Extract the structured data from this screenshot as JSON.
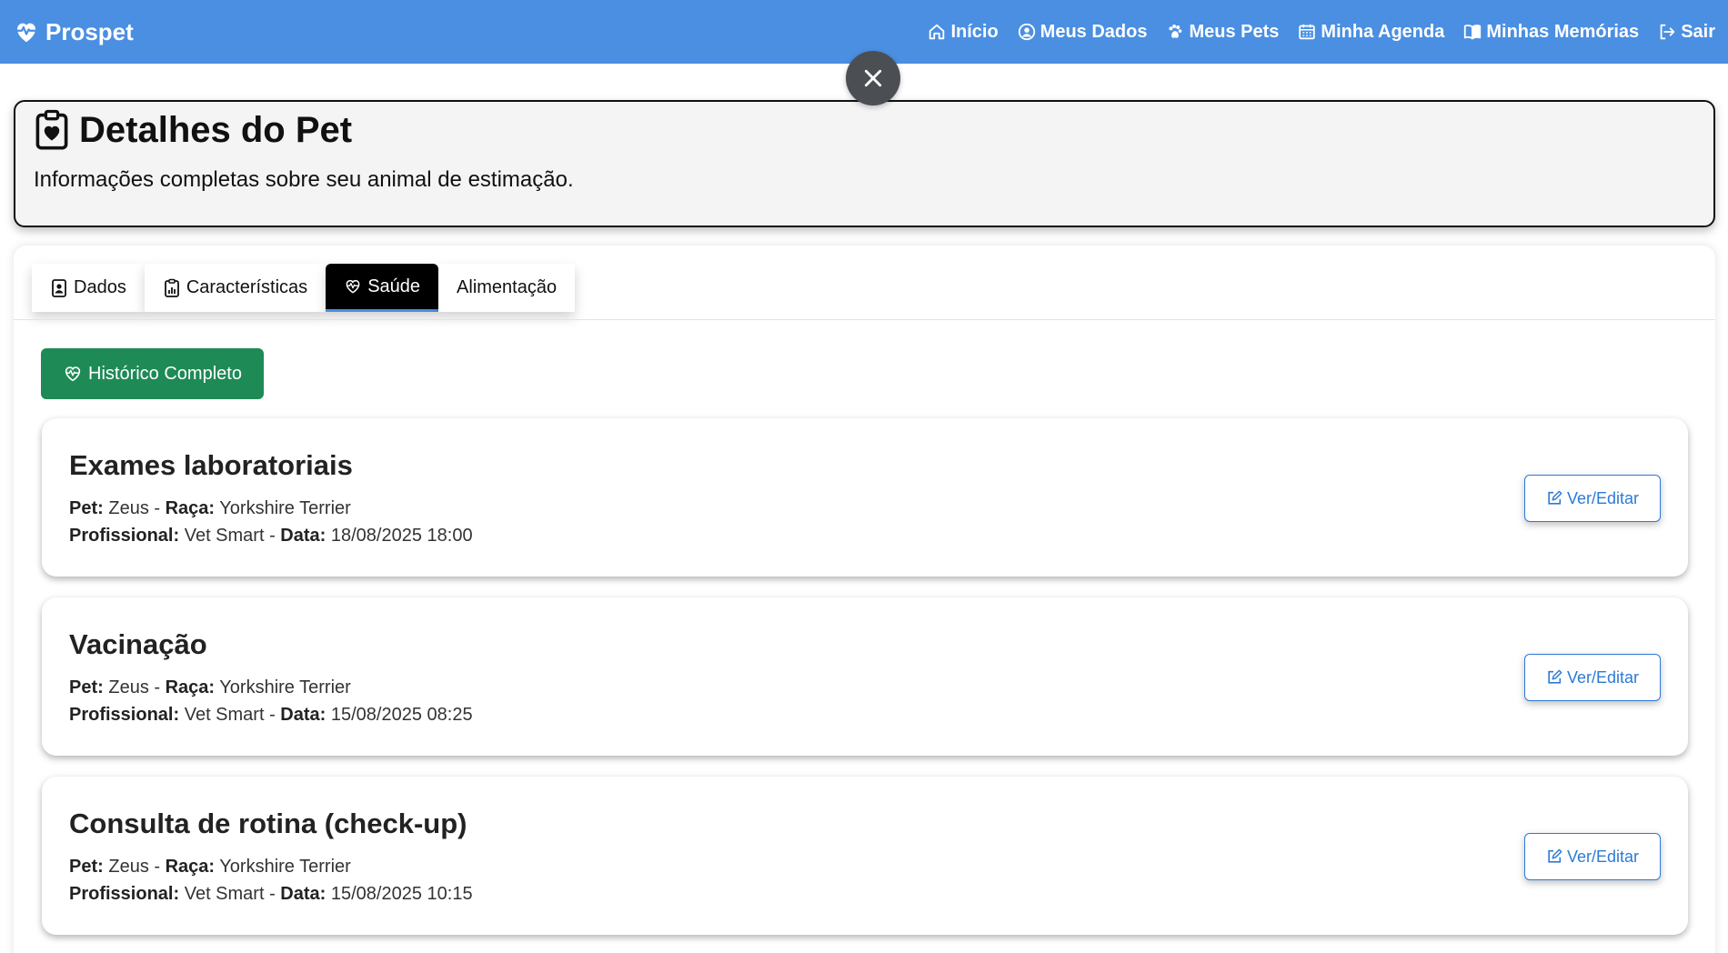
{
  "navbar": {
    "brand": "Prospet",
    "links": [
      {
        "label": "Início",
        "icon": "home-icon"
      },
      {
        "label": "Meus Dados",
        "icon": "user-circle-icon"
      },
      {
        "label": "Meus Pets",
        "icon": "paw-icon"
      },
      {
        "label": "Minha Agenda",
        "icon": "calendar-icon"
      },
      {
        "label": "Minhas Memórias",
        "icon": "book-icon"
      },
      {
        "label": "Sair",
        "icon": "logout-icon"
      }
    ]
  },
  "header": {
    "title": "Detalhes do Pet",
    "subtitle": "Informações completas sobre seu animal de estimação."
  },
  "tabs": [
    {
      "label": "Dados",
      "icon": "id-badge-icon",
      "active": false
    },
    {
      "label": "Características",
      "icon": "clipboard-chart-icon",
      "active": false
    },
    {
      "label": "Saúde",
      "icon": "heart-pulse-icon",
      "active": true
    },
    {
      "label": "Alimentação",
      "icon": "",
      "active": false
    }
  ],
  "history_button": "Histórico Completo",
  "labels": {
    "pet": "Pet:",
    "breed": "Raça:",
    "professional": "Profissional:",
    "date": "Data:",
    "separator": " - "
  },
  "edit_button": "Ver/Editar",
  "records": [
    {
      "title": "Exames laboratoriais",
      "pet": "Zeus",
      "breed": "Yorkshire Terrier",
      "professional": "Vet Smart",
      "date": "18/08/2025 18:00"
    },
    {
      "title": "Vacinação",
      "pet": "Zeus",
      "breed": "Yorkshire Terrier",
      "professional": "Vet Smart",
      "date": "15/08/2025 08:25"
    },
    {
      "title": "Consulta de rotina (check-up)",
      "pet": "Zeus",
      "breed": "Yorkshire Terrier",
      "professional": "Vet Smart",
      "date": "15/08/2025 10:15"
    }
  ],
  "colors": {
    "navbar": "#4a8fe2",
    "success": "#1e8a55",
    "primary": "#2d7ad6",
    "active_tab": "#000000"
  }
}
